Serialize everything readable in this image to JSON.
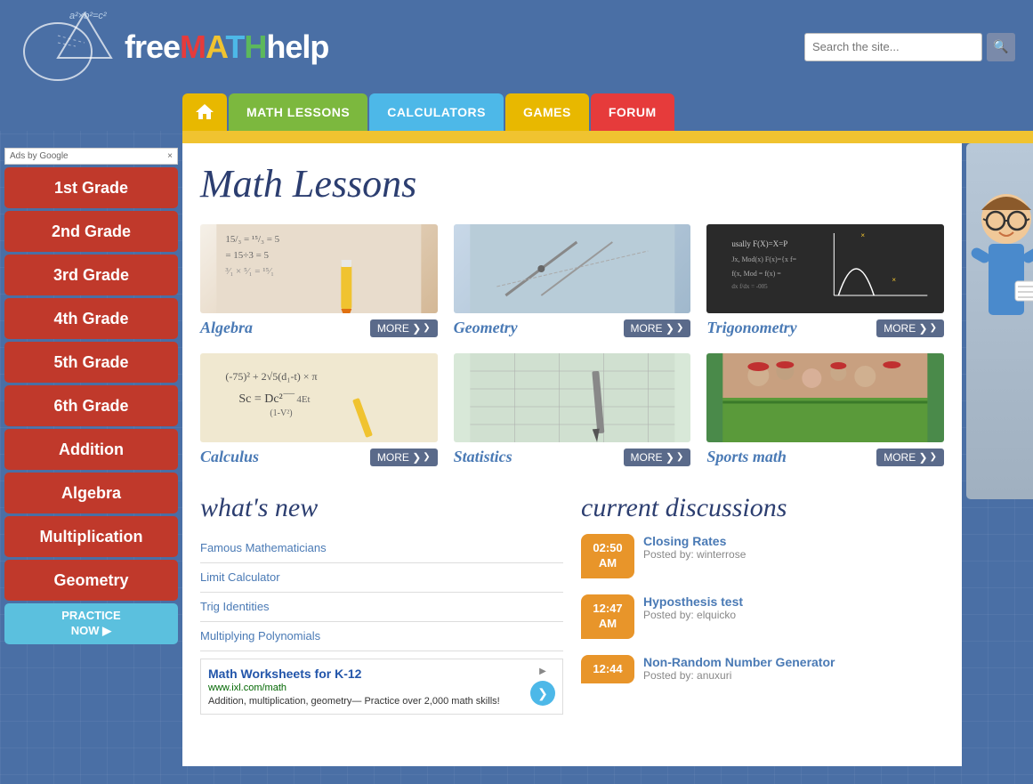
{
  "site": {
    "name": "freeMATHhelp",
    "logo_parts": {
      "free": "free",
      "M": "M",
      "A": "A",
      "T": "T",
      "H": "H",
      "help": "help"
    },
    "formula": "a²×b²=c²"
  },
  "search": {
    "placeholder": "Search the site...",
    "button_label": "🔍"
  },
  "nav": {
    "home_label": "🏠",
    "items": [
      {
        "id": "math-lessons",
        "label": "MATH LESSONS"
      },
      {
        "id": "calculators",
        "label": "CALCULATORS"
      },
      {
        "id": "games",
        "label": "GAMES"
      },
      {
        "id": "forum",
        "label": "FORUM"
      }
    ]
  },
  "sidebar": {
    "ad_label": "Ads by Google",
    "close_label": "×",
    "grade_buttons": [
      {
        "id": "grade-1",
        "label": "1st Grade"
      },
      {
        "id": "grade-2",
        "label": "2nd Grade"
      },
      {
        "id": "grade-3",
        "label": "3rd Grade"
      },
      {
        "id": "grade-4",
        "label": "4th Grade"
      },
      {
        "id": "grade-5",
        "label": "5th Grade"
      },
      {
        "id": "grade-6",
        "label": "6th Grade"
      },
      {
        "id": "addition",
        "label": "Addition"
      },
      {
        "id": "algebra",
        "label": "Algebra"
      },
      {
        "id": "multiplication",
        "label": "Multiplication"
      },
      {
        "id": "geometry",
        "label": "Geometry"
      }
    ],
    "practice_label": "PRACTICE\nNOW ▶"
  },
  "lessons": {
    "title": "Math Lessons",
    "cards": [
      {
        "id": "algebra",
        "label": "Algebra",
        "more": "MORE"
      },
      {
        "id": "geometry",
        "label": "Geometry",
        "more": "MORE"
      },
      {
        "id": "trigonometry",
        "label": "Trigonometry",
        "more": "MORE"
      },
      {
        "id": "calculus",
        "label": "Calculus",
        "more": "MORE"
      },
      {
        "id": "statistics",
        "label": "Statistics",
        "more": "MORE"
      },
      {
        "id": "sports-math",
        "label": "Sports math",
        "more": "MORE"
      }
    ]
  },
  "whats_new": {
    "title": "what's new",
    "items": [
      {
        "label": "Famous Mathematicians"
      },
      {
        "label": "Limit Calculator"
      },
      {
        "label": "Trig Identities"
      },
      {
        "label": "Multiplying Polynomials"
      }
    ],
    "ad": {
      "title": "Math Worksheets for K-12",
      "url": "www.ixl.com/math",
      "description": "Addition, multiplication, geometry— Practice over 2,000 math skills!"
    }
  },
  "discussions": {
    "title": "current discussions",
    "items": [
      {
        "time": "02:50\nAM",
        "title": "Closing Rates",
        "posted": "Posted by: winterrose"
      },
      {
        "time": "12:47\nAM",
        "title": "Hyposthesis test",
        "posted": "Posted by: elquicko"
      },
      {
        "time": "12:44",
        "title": "Non-Random Number Generator",
        "posted": "Posted by: anuxuri"
      }
    ]
  }
}
